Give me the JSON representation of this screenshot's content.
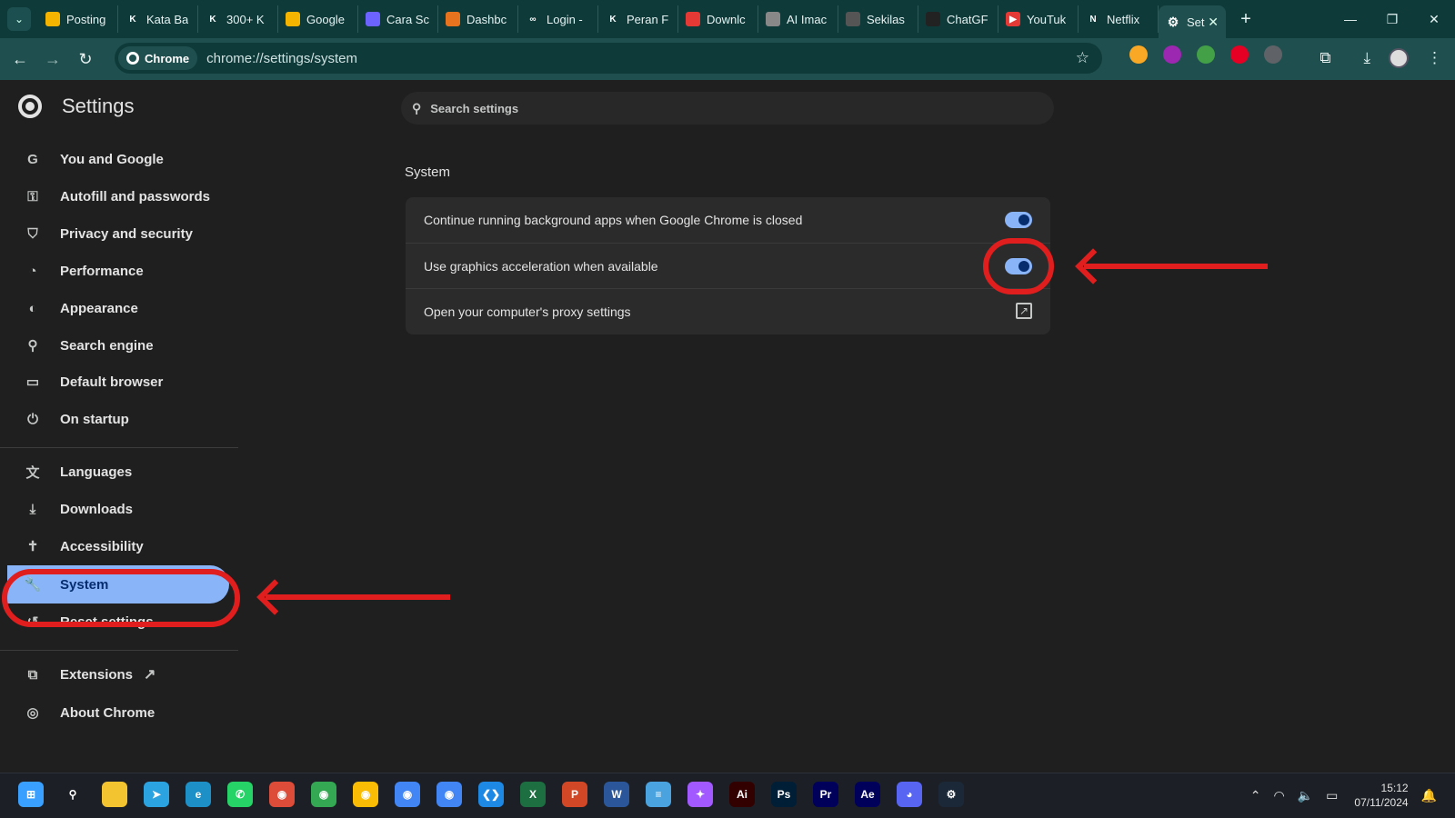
{
  "tabs": [
    {
      "label": "Posting",
      "color": "#f4b400",
      "glyph": ""
    },
    {
      "label": "Kata Ba",
      "color": "#0f3a3a",
      "glyph": "K"
    },
    {
      "label": "300+ K",
      "color": "#0f3a3a",
      "glyph": "K"
    },
    {
      "label": "Google",
      "color": "#f4b400",
      "glyph": ""
    },
    {
      "label": "Cara Sc",
      "color": "#6c63ff",
      "glyph": ""
    },
    {
      "label": "Dashbc",
      "color": "#e8731e",
      "glyph": ""
    },
    {
      "label": "Login -",
      "color": "#0f3a3a",
      "glyph": "∞"
    },
    {
      "label": "Peran F",
      "color": "#0f3a3a",
      "glyph": "K"
    },
    {
      "label": "Downlc",
      "color": "#e53935",
      "glyph": ""
    },
    {
      "label": "AI Imac",
      "color": "#888888",
      "glyph": ""
    },
    {
      "label": "Sekilas",
      "color": "#555555",
      "glyph": ""
    },
    {
      "label": "ChatGF",
      "color": "#222222",
      "glyph": ""
    },
    {
      "label": "YouTuk",
      "color": "#e53935",
      "glyph": "▶"
    },
    {
      "label": "Netflix",
      "color": "#0f3a3a",
      "glyph": "N"
    }
  ],
  "active_tab": {
    "label": "Set",
    "icon": "gear-icon"
  },
  "omnibox": {
    "chip_label": "Chrome",
    "url": "chrome://settings/system"
  },
  "extension_colors": [
    "#f9a825",
    "#9c27b0",
    "#43a047",
    "#e60023",
    "#5f6368"
  ],
  "settings": {
    "title": "Settings",
    "search_placeholder": "Search settings",
    "nav_group1": [
      {
        "label": "You and Google",
        "icon": "google-icon",
        "glyph": "G"
      },
      {
        "label": "Autofill and passwords",
        "icon": "key-icon",
        "glyph": "⚿"
      },
      {
        "label": "Privacy and security",
        "icon": "shield-icon",
        "glyph": "⛉"
      },
      {
        "label": "Performance",
        "icon": "speedometer-icon",
        "glyph": "◔"
      },
      {
        "label": "Appearance",
        "icon": "palette-icon",
        "glyph": "◐"
      },
      {
        "label": "Search engine",
        "icon": "search-icon",
        "glyph": "⚲"
      },
      {
        "label": "Default browser",
        "icon": "browser-icon",
        "glyph": "▭"
      },
      {
        "label": "On startup",
        "icon": "power-icon",
        "glyph": "⏻"
      }
    ],
    "nav_group2": [
      {
        "label": "Languages",
        "icon": "translate-icon",
        "glyph": "文"
      },
      {
        "label": "Downloads",
        "icon": "download-icon",
        "glyph": "⤓"
      },
      {
        "label": "Accessibility",
        "icon": "accessibility-icon",
        "glyph": "✝"
      },
      {
        "label": "System",
        "icon": "wrench-icon",
        "glyph": "🔧"
      },
      {
        "label": "Reset settings",
        "icon": "reset-icon",
        "glyph": "↺"
      }
    ],
    "nav_group3": [
      {
        "label": "Extensions",
        "icon": "puzzle-icon",
        "glyph": "⧉"
      },
      {
        "label": "About Chrome",
        "icon": "chrome-icon",
        "glyph": "◎"
      }
    ],
    "section_title": "System",
    "rows": {
      "background_apps": {
        "label": "Continue running background apps when Google Chrome is closed",
        "enabled": true
      },
      "graphics_acceleration": {
        "label": "Use graphics acceleration when available",
        "enabled": true
      },
      "proxy": {
        "label": "Open your computer's proxy settings"
      }
    }
  },
  "taskbar": {
    "apps": [
      {
        "name": "windows-start",
        "color": "#3aa0ff",
        "glyph": "⊞"
      },
      {
        "name": "search",
        "color": "transparent",
        "glyph": "⚲"
      },
      {
        "name": "file-explorer",
        "color": "#f4c430",
        "glyph": ""
      },
      {
        "name": "telegram",
        "color": "#2aa3e0",
        "glyph": "➤"
      },
      {
        "name": "edge",
        "color": "#1e90c8",
        "glyph": "e"
      },
      {
        "name": "whatsapp",
        "color": "#25d366",
        "glyph": "✆"
      },
      {
        "name": "chrome",
        "color": "#dd4b39",
        "glyph": "◉"
      },
      {
        "name": "chrome",
        "color": "#34a853",
        "glyph": "◉"
      },
      {
        "name": "chrome",
        "color": "#fbbc05",
        "glyph": "◉"
      },
      {
        "name": "chrome",
        "color": "#4285f4",
        "glyph": "◉"
      },
      {
        "name": "chrome",
        "color": "#4285f4",
        "glyph": "◉"
      },
      {
        "name": "vscode",
        "color": "#1e88e5",
        "glyph": "❮❯"
      },
      {
        "name": "excel",
        "color": "#1d6f42",
        "glyph": "X"
      },
      {
        "name": "powerpoint",
        "color": "#d24726",
        "glyph": "P"
      },
      {
        "name": "word",
        "color": "#2b579a",
        "glyph": "W"
      },
      {
        "name": "notepad",
        "color": "#4aa3df",
        "glyph": "≡"
      },
      {
        "name": "figma",
        "color": "#a259ff",
        "glyph": "✦"
      },
      {
        "name": "illustrator",
        "color": "#330000",
        "glyph": "Ai"
      },
      {
        "name": "photoshop",
        "color": "#001e36",
        "glyph": "Ps"
      },
      {
        "name": "premiere",
        "color": "#00005b",
        "glyph": "Pr"
      },
      {
        "name": "after-effects",
        "color": "#00005b",
        "glyph": "Ae"
      },
      {
        "name": "discord",
        "color": "#5865f2",
        "glyph": "◕"
      },
      {
        "name": "steam",
        "color": "#1b2838",
        "glyph": "⚙"
      }
    ],
    "time": "15:12",
    "date": "07/11/2024"
  }
}
